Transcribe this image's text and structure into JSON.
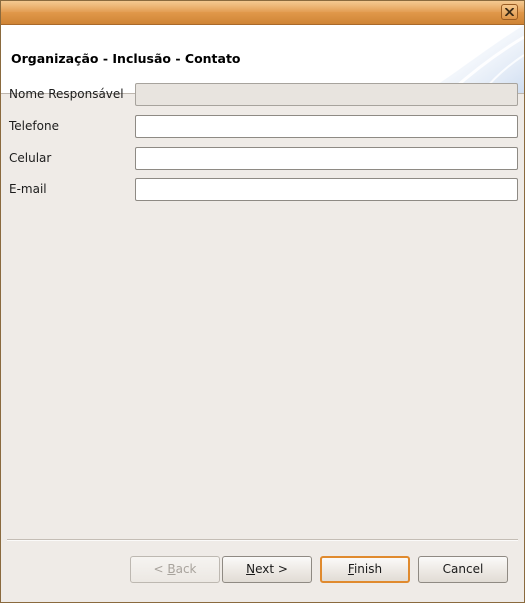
{
  "window": {
    "close_glyph": "✕"
  },
  "banner": {
    "title": "Organização - Inclusão - Contato"
  },
  "form": {
    "fields": [
      {
        "label": "Nome Responsável",
        "value": "",
        "enabled": false
      },
      {
        "label": "Telefone",
        "value": "",
        "enabled": true
      },
      {
        "label": "Celular",
        "value": "",
        "enabled": true
      },
      {
        "label": "E-mail",
        "value": "",
        "enabled": true
      }
    ]
  },
  "buttons": {
    "back": {
      "prefix": "< ",
      "mnemonic": "B",
      "rest": "ack",
      "enabled": false
    },
    "next": {
      "prefix": "",
      "mnemonic": "N",
      "rest": "ext >",
      "enabled": true
    },
    "finish": {
      "prefix": "",
      "mnemonic": "F",
      "rest": "inish",
      "enabled": true,
      "default": true
    },
    "cancel": {
      "label": "Cancel",
      "enabled": true
    }
  },
  "colors": {
    "titlebar": "#e29a4c",
    "default_button_border": "#e08a2e",
    "window_bg": "#efebe7"
  },
  "icons": {
    "close": "close-icon",
    "banner_art": "banner-decoration"
  }
}
